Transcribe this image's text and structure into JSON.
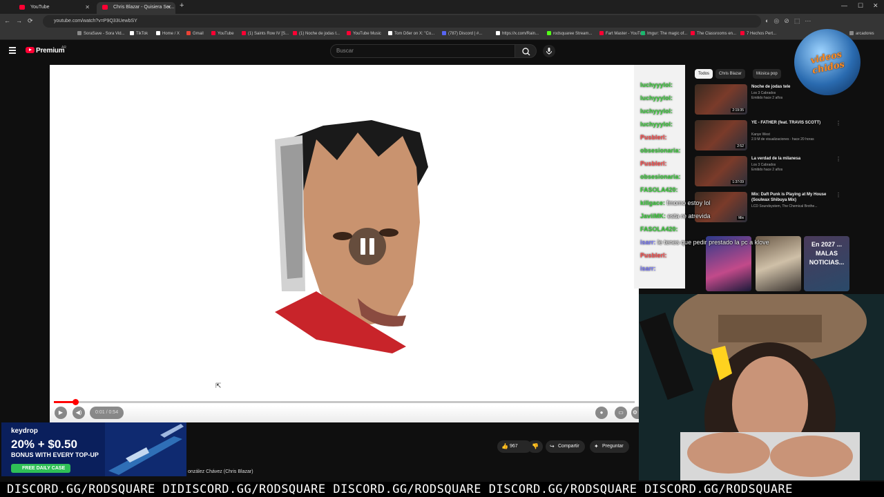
{
  "browser": {
    "tabs": [
      {
        "title": "YouTube"
      },
      {
        "title": "Chris Blazar - Quisiera Ser..."
      }
    ],
    "url": "youtube.com/watch?v=P9Q33UewbSY",
    "bookmarks": [
      {
        "label": "SoraSave - Sora Vid...",
        "color": "#888888"
      },
      {
        "label": "TikTok",
        "color": "#ffffff"
      },
      {
        "label": "Home / X",
        "color": "#ffffff"
      },
      {
        "label": "Gmail",
        "color": "#ea4335"
      },
      {
        "label": "YouTube",
        "color": "#ff0033"
      },
      {
        "label": "(1) Saints Row IV [S...",
        "color": "#ff0033"
      },
      {
        "label": "(1) Noche de jodas t...",
        "color": "#ff0033"
      },
      {
        "label": "YouTube Music",
        "color": "#ff0033"
      },
      {
        "label": "Tom Dőer on X: \"Co...",
        "color": "#ffffff"
      },
      {
        "label": "(787) Discord | #...",
        "color": "#5865f2"
      },
      {
        "label": "https://x.com/Rain...",
        "color": "#ffffff"
      },
      {
        "label": "rodsquaree Stream...",
        "color": "#53fc18"
      },
      {
        "label": "Fart Master - YouTu...",
        "color": "#ff0033"
      },
      {
        "label": "Imgur: The magic of...",
        "color": "#1bb76e"
      },
      {
        "label": "The Classrooms en...",
        "color": "#ff0033"
      },
      {
        "label": "7 Hechos Pert...",
        "color": "#ff0033"
      },
      {
        "label": "arcadores",
        "color": "#888888"
      }
    ]
  },
  "header": {
    "premium_label": "Premium",
    "region": "AR",
    "search_placeholder": "Buscar"
  },
  "player": {
    "time_label": "0:01 / 0:54",
    "progress_played": 0.037,
    "progress_buffered": 0.39
  },
  "actions": {
    "like_count": "967",
    "share_label": "Compartir",
    "ask_label": "Preguntar"
  },
  "channel_line": "onzález Chávez (Chris Blazar)",
  "chat": [
    {
      "user": "luchyyylol:",
      "color": "#3ad13a",
      "msg": ""
    },
    {
      "user": "luchyyylol:",
      "color": "#3ad13a",
      "msg": ""
    },
    {
      "user": "luchyyylol:",
      "color": "#3ad13a",
      "msg": ""
    },
    {
      "user": "luchyyylol:",
      "color": "#3ad13a",
      "msg": ""
    },
    {
      "user": "Pusblerl:",
      "color": "#ff4d4d",
      "msg": ""
    },
    {
      "user": "obsesionaria:",
      "color": "#3ad13a",
      "msg": ""
    },
    {
      "user": "Pusblerl:",
      "color": "#ff4d4d",
      "msg": ""
    },
    {
      "user": "obsesionaria:",
      "color": "#3ad13a",
      "msg": ""
    },
    {
      "user": "FASOLA420:",
      "color": "#3ad13a",
      "msg": ""
    },
    {
      "user": "killgace:",
      "color": "#3ad13a",
      "msg": "fmomo estoy lol"
    },
    {
      "user": "JaviiMK:",
      "color": "#3ad13a",
      "msg": "esta re atrevida"
    },
    {
      "user": "FASOLA420:",
      "color": "#3ad13a",
      "msg": ""
    },
    {
      "user": "isarr:",
      "color": "#7a7aff",
      "msg": "le tenes que pedir prestado la pc a klove"
    },
    {
      "user": "Pusblerl:",
      "color": "#ff4d4d",
      "msg": ""
    },
    {
      "user": "isarr:",
      "color": "#7a7aff",
      "msg": ""
    }
  ],
  "sidebar": {
    "chips": [
      "Todos",
      "Chris Blazar",
      "Música pop"
    ],
    "recommendations": [
      {
        "title": "Noche de jodas tele",
        "channel": "Los 3 Cabrados",
        "meta": "Emitido hace 2 años",
        "duration": "2:19:35"
      },
      {
        "title": "YE - FATHER (feat. TRAVIS SCOTT)",
        "channel": "Kanye West",
        "meta": "2.9 M de visualizaciones · hace 20 horas",
        "duration": "2:52"
      },
      {
        "title": "La verdad de la milanesa",
        "channel": "Los 3 Cabrados",
        "meta": "Emitido hace 2 años",
        "duration": "1:37:09"
      },
      {
        "title": "Mix: Daft Punk is Playing at My House (Soulwax Shibuya Mix)",
        "channel": "LCD Soundsystem, The Chemical Brothe...",
        "meta": "",
        "duration": "Mix"
      }
    ],
    "shorts": [
      {
        "label": ""
      },
      {
        "label": ""
      },
      {
        "label": "En 2027 ... MALAS NOTICIAS..."
      }
    ]
  },
  "logo_text": "videos chidos",
  "ad": {
    "brand": "keydrop",
    "headline": "20% + $0.50",
    "sub": "BONUS WITH EVERY TOP-UP",
    "button": "FREE DAILY CASE"
  },
  "ticker": "DISCORD.GG/RODSQUARE DIDISCORD.GG/RODSQUARE DISCORD.GG/RODSQUARE DISCORD.GG/RODSQUARE DISCORD.GG/RODSQUARE"
}
